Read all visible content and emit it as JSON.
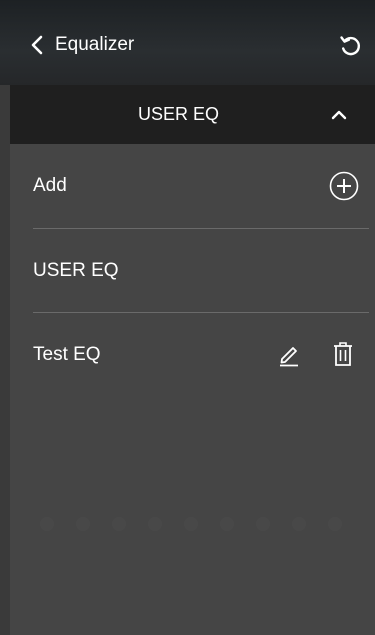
{
  "header": {
    "title": "Equalizer",
    "back_icon": "chevron-left-icon",
    "reset_icon": "reset-icon"
  },
  "dropdown": {
    "selected": "USER EQ",
    "toggle_icon": "chevron-up-icon"
  },
  "list": {
    "items": [
      {
        "label": "Add",
        "action_icon": "add-circle-icon"
      },
      {
        "label": "USER EQ"
      },
      {
        "label": "Test EQ",
        "action_icons": [
          "edit-icon",
          "trash-icon"
        ]
      }
    ]
  },
  "colors": {
    "background": "#3a3a3a",
    "header": "#2a2e31",
    "dropdown_bar": "#1f1f1f",
    "panel": "#484848",
    "divider": "#6a6a6a",
    "text": "#ffffff"
  }
}
